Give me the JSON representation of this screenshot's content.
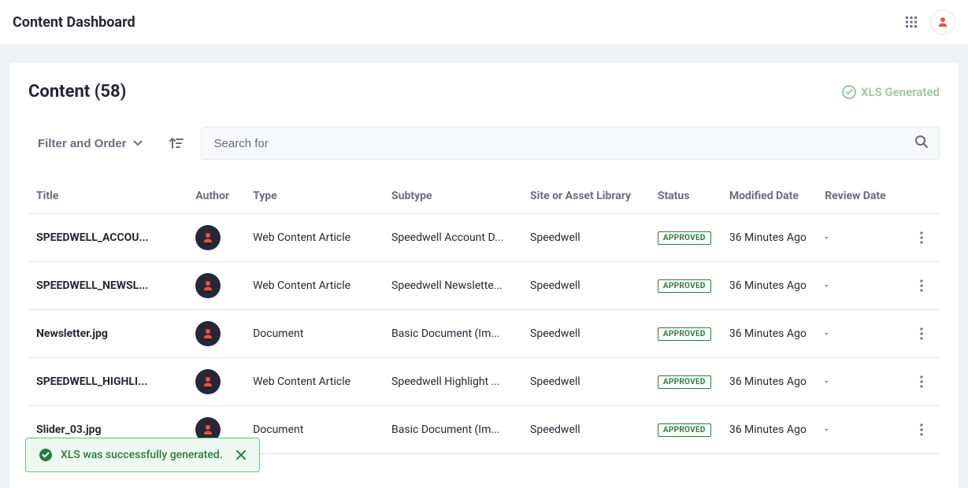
{
  "header": {
    "title": "Content Dashboard"
  },
  "panel": {
    "heading": "Content (58)",
    "xls_status": "XLS Generated"
  },
  "toolbar": {
    "filter_label": "Filter and Order",
    "search_placeholder": "Search for"
  },
  "table": {
    "columns": {
      "title": "Title",
      "author": "Author",
      "type": "Type",
      "subtype": "Subtype",
      "site": "Site or Asset Library",
      "status": "Status",
      "modified": "Modified Date",
      "review": "Review Date"
    },
    "rows": [
      {
        "title": "SPEEDWELL_ACCOU...",
        "type": "Web Content Article",
        "subtype": "Speedwell Account D...",
        "site": "Speedwell",
        "status": "APPROVED",
        "modified": "36 Minutes Ago",
        "review": "-"
      },
      {
        "title": "SPEEDWELL_NEWSL...",
        "type": "Web Content Article",
        "subtype": "Speedwell Newslette...",
        "site": "Speedwell",
        "status": "APPROVED",
        "modified": "36 Minutes Ago",
        "review": "-"
      },
      {
        "title": "Newsletter.jpg",
        "type": "Document",
        "subtype": "Basic Document (Im...",
        "site": "Speedwell",
        "status": "APPROVED",
        "modified": "36 Minutes Ago",
        "review": "-"
      },
      {
        "title": "SPEEDWELL_HIGHLI...",
        "type": "Web Content Article",
        "subtype": "Speedwell Highlight ...",
        "site": "Speedwell",
        "status": "APPROVED",
        "modified": "36 Minutes Ago",
        "review": "-"
      },
      {
        "title": "Slider_03.jpg",
        "type": "Document",
        "subtype": "Basic Document (Im...",
        "site": "Speedwell",
        "status": "APPROVED",
        "modified": "36 Minutes Ago",
        "review": "-"
      }
    ]
  },
  "toast": {
    "message": "XLS was successfully generated."
  }
}
